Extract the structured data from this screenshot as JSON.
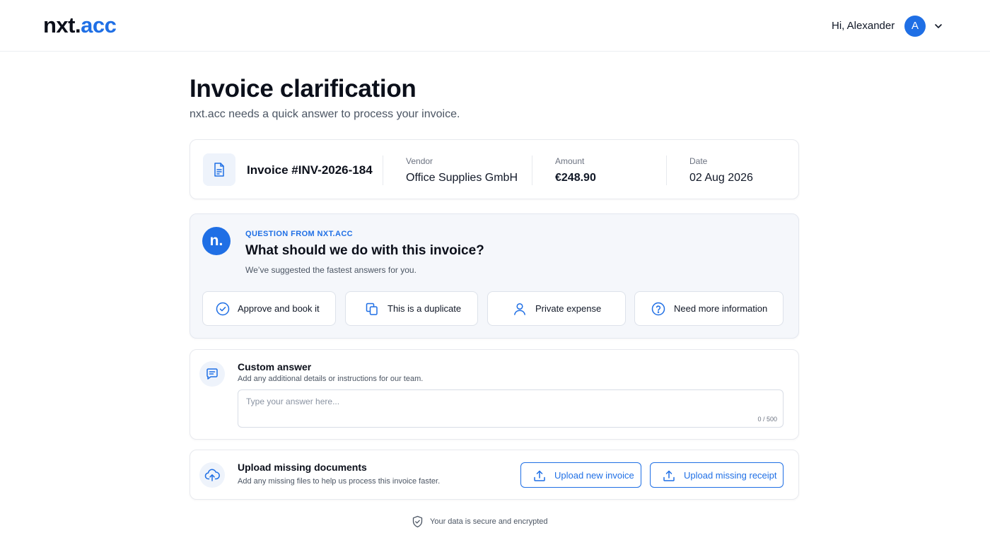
{
  "header": {
    "logo_part1": "nxt.",
    "logo_part2": "acc",
    "greeting": "Hi, Alexander",
    "avatar_initial": "A"
  },
  "page": {
    "title": "Invoice clarification",
    "subtitle": "nxt.acc needs a quick answer to process your invoice."
  },
  "invoice": {
    "number": "Invoice #INV-2026-184",
    "vendor_label": "Vendor",
    "vendor": "Office Supplies GmbH",
    "amount_label": "Amount",
    "amount": "€248.90",
    "date_label": "Date",
    "date": "02 Aug 2026"
  },
  "question": {
    "badge": "n.",
    "eyebrow": "QUESTION FROM NXT.ACC",
    "title": "What should we do with this invoice?",
    "subtitle": "We’ve suggested the fastest answers for you.",
    "options": [
      {
        "label": "Approve and book it",
        "icon": "check-circle-icon"
      },
      {
        "label": "This is a duplicate",
        "icon": "duplicate-icon"
      },
      {
        "label": "Private expense",
        "icon": "user-icon"
      },
      {
        "label": "Need more information",
        "icon": "question-circle-icon"
      }
    ]
  },
  "custom": {
    "title": "Custom answer",
    "subtitle": "Add any additional details or instructions for our team.",
    "placeholder": "Type your answer here...",
    "counter": "0 / 500"
  },
  "upload": {
    "title": "Upload missing documents",
    "subtitle": "Add any missing files to help us process this invoice faster.",
    "btn_invoice": "Upload new invoice",
    "btn_receipt": "Upload missing receipt"
  },
  "footer": {
    "secure_text": "Your data is secure and encrypted"
  },
  "colors": {
    "accent": "#1f6fe5",
    "text": "#0b0f1a",
    "muted": "#4b5563",
    "card_tint": "#f5f7fb"
  }
}
